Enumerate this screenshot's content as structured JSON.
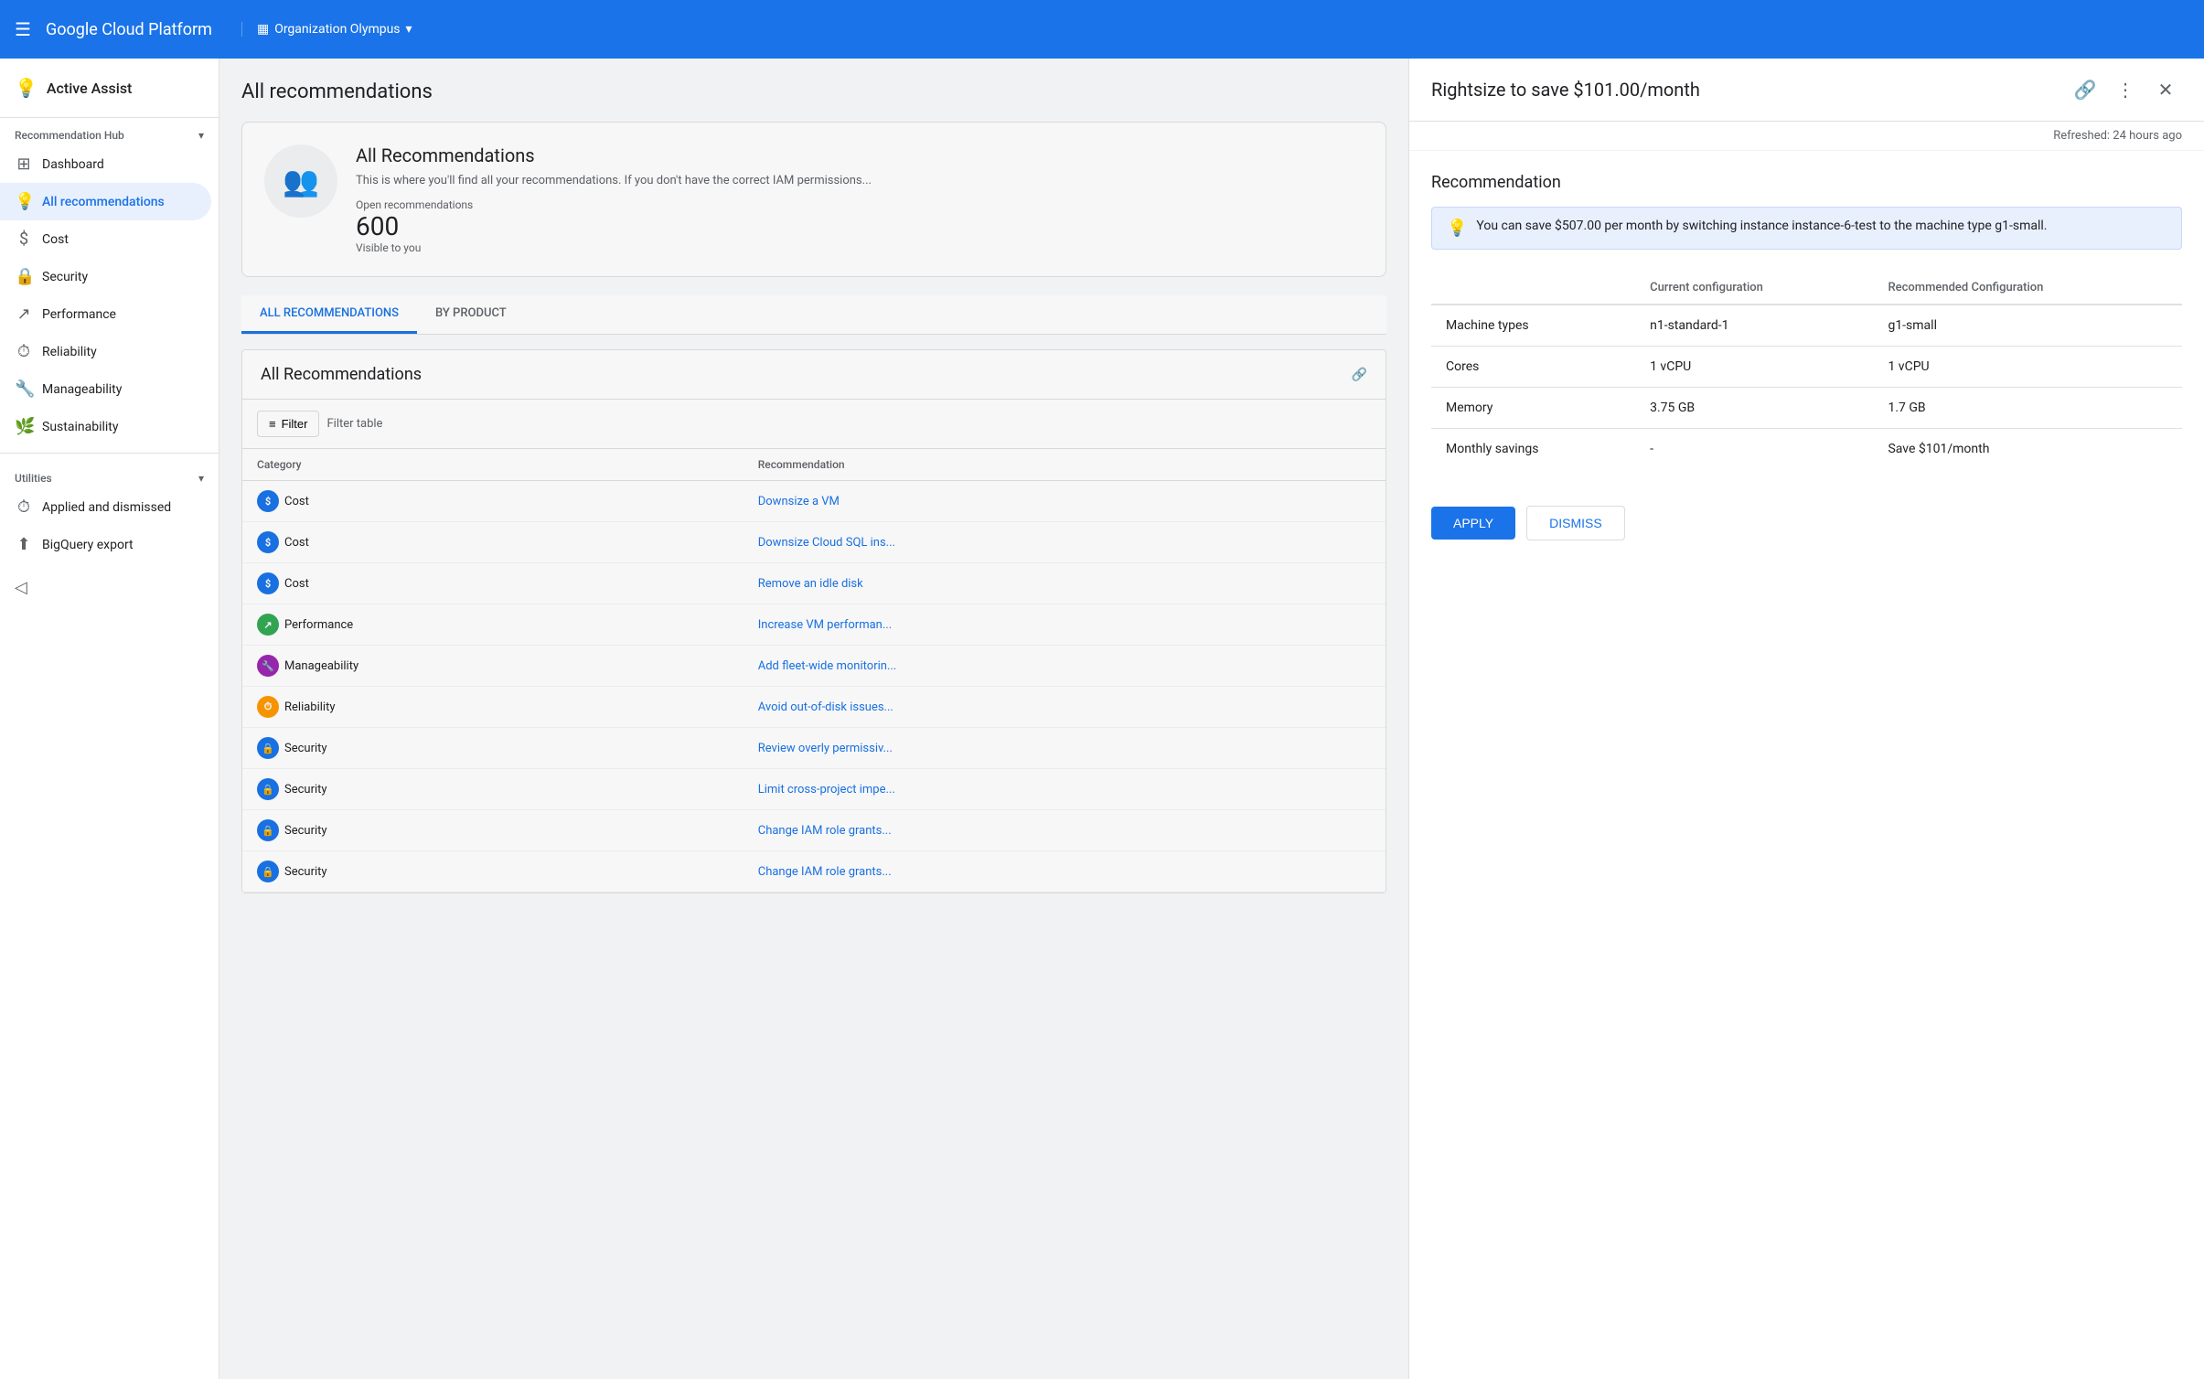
{
  "topbar": {
    "menu_label": "☰",
    "title": "Google Cloud Platform",
    "org_icon": "▦",
    "org_name": "Organization Olympus",
    "org_chevron": "▾"
  },
  "sidebar": {
    "active_assist_label": "Active Assist",
    "active_assist_icon": "💡",
    "recommendation_hub_label": "Recommendation Hub",
    "recommendation_hub_chevron": "▾",
    "items": [
      {
        "id": "dashboard",
        "label": "Dashboard",
        "icon": "⊞"
      },
      {
        "id": "all-recommendations",
        "label": "All recommendations",
        "icon": "💡",
        "active": true
      },
      {
        "id": "cost",
        "label": "Cost",
        "icon": "$"
      },
      {
        "id": "security",
        "label": "Security",
        "icon": "🔒"
      },
      {
        "id": "performance",
        "label": "Performance",
        "icon": "↗"
      },
      {
        "id": "reliability",
        "label": "Reliability",
        "icon": "⏱"
      },
      {
        "id": "manageability",
        "label": "Manageability",
        "icon": "🔧"
      },
      {
        "id": "sustainability",
        "label": "Sustainability",
        "icon": "🌿"
      }
    ],
    "utilities_label": "Utilities",
    "utilities_chevron": "▾",
    "utilities_items": [
      {
        "id": "applied-dismissed",
        "label": "Applied and dismissed",
        "icon": "⏱"
      },
      {
        "id": "bigquery-export",
        "label": "BigQuery export",
        "icon": "⬆"
      }
    ],
    "collapse_icon": "◁"
  },
  "main": {
    "title": "All recommendations",
    "banner": {
      "icon": "👥",
      "heading": "All Recommendations",
      "description": "This is where you'll find all your recommendations. If you don't have the correct IAM permissions...",
      "open_reco_label": "Open recommendations",
      "open_reco_count": "600",
      "open_reco_visible": "Visible to you"
    },
    "tabs": [
      {
        "id": "all",
        "label": "ALL RECOMMENDATIONS",
        "active": true
      },
      {
        "id": "by-product",
        "label": "BY PRODUCT"
      }
    ],
    "all_reco_title": "All Recommendations",
    "filter_label": "Filter",
    "filter_table_label": "Filter table",
    "table_headers": [
      "Category",
      "Recommendation"
    ],
    "rows": [
      {
        "category": "Cost",
        "category_type": "cost",
        "recommendation": "Downsize a VM"
      },
      {
        "category": "Cost",
        "category_type": "cost",
        "recommendation": "Downsize Cloud SQL ins..."
      },
      {
        "category": "Cost",
        "category_type": "cost",
        "recommendation": "Remove an idle disk"
      },
      {
        "category": "Performance",
        "category_type": "perf",
        "recommendation": "Increase VM performan..."
      },
      {
        "category": "Manageability",
        "category_type": "mgmt",
        "recommendation": "Add fleet-wide monitorin..."
      },
      {
        "category": "Reliability",
        "category_type": "rel",
        "recommendation": "Avoid out-of-disk issues..."
      },
      {
        "category": "Security",
        "category_type": "sec",
        "recommendation": "Review overly permissiv..."
      },
      {
        "category": "Security",
        "category_type": "sec",
        "recommendation": "Limit cross-project impe..."
      },
      {
        "category": "Security",
        "category_type": "sec",
        "recommendation": "Change IAM role grants..."
      },
      {
        "category": "Security",
        "category_type": "sec",
        "recommendation": "Change IAM role grants..."
      }
    ]
  },
  "side_panel": {
    "title": "Rightsize to save $101.00/month",
    "link_icon": "🔗",
    "more_icon": "⋮",
    "close_icon": "✕",
    "refreshed_label": "Refreshed: 24 hours ago",
    "recommendation_section_label": "Recommendation",
    "info_text": "You can save $507.00 per month by switching instance instance-6-test to the machine type g1-small.",
    "config_table": {
      "headers": [
        "",
        "Current configuration",
        "Recommended Configuration"
      ],
      "rows": [
        {
          "attribute": "Machine types",
          "current": "n1-standard-1",
          "recommended": "g1-small"
        },
        {
          "attribute": "Cores",
          "current": "1 vCPU",
          "recommended": "1 vCPU"
        },
        {
          "attribute": "Memory",
          "current": "3.75 GB",
          "recommended": "1.7 GB"
        },
        {
          "attribute": "Monthly savings",
          "current": "-",
          "recommended": "Save $101/month"
        }
      ]
    },
    "apply_label": "APPLY",
    "dismiss_label": "DISMISS"
  }
}
